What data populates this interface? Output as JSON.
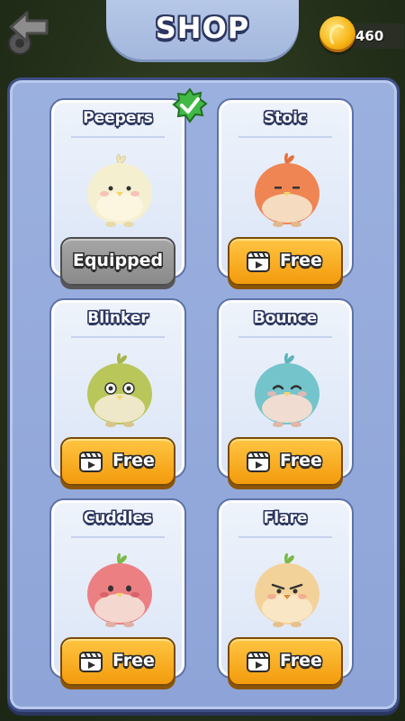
{
  "header": {
    "title": "SHOP",
    "back_icon": "back-arrow-icon",
    "settings_icon": "gear-icon"
  },
  "currency": {
    "coins": "460",
    "icon": "coin-icon"
  },
  "colors": {
    "panel": "#8ea4d8",
    "free_button": "#f7a81b",
    "equipped_button": "#8a8a8a",
    "badge": "#3fb23f"
  },
  "characters": [
    {
      "name": "Peepers",
      "button": "Equipped",
      "equipped": true,
      "color": "#f4efcf"
    },
    {
      "name": "Stoic",
      "button": "Free",
      "equipped": false,
      "color": "#ef8552"
    },
    {
      "name": "Blinker",
      "button": "Free",
      "equipped": false,
      "color": "#b9c65a"
    },
    {
      "name": "Bounce",
      "button": "Free",
      "equipped": false,
      "color": "#74c4cc"
    },
    {
      "name": "Cuddles",
      "button": "Free",
      "equipped": false,
      "color": "#ec7f82"
    },
    {
      "name": "Flare",
      "button": "Free",
      "equipped": false,
      "color": "#f3d29a"
    }
  ]
}
